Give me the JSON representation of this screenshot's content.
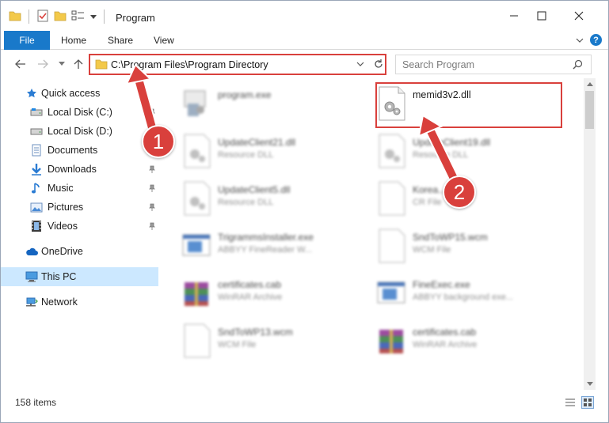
{
  "window": {
    "title": "Program"
  },
  "ribbon": {
    "file_tab": "File",
    "tabs": [
      "Home",
      "Share",
      "View"
    ],
    "help": "?"
  },
  "address": {
    "path": "C:\\Program Files\\Program Directory"
  },
  "search": {
    "placeholder": "Search Program"
  },
  "nav": {
    "items": [
      {
        "label": "Quick access",
        "icon": "star-icon"
      },
      {
        "label": "Local Disk (C:)",
        "icon": "drive-icon"
      },
      {
        "label": "Local Disk (D:)",
        "icon": "drive-icon"
      },
      {
        "label": "Documents",
        "icon": "documents-icon"
      },
      {
        "label": "Downloads",
        "icon": "download-icon"
      },
      {
        "label": "Music",
        "icon": "music-icon"
      },
      {
        "label": "Pictures",
        "icon": "pictures-icon"
      },
      {
        "label": "Videos",
        "icon": "videos-icon"
      },
      {
        "label": "OneDrive",
        "icon": "cloud-icon"
      },
      {
        "label": "This PC",
        "icon": "computer-icon"
      },
      {
        "label": "Network",
        "icon": "network-icon"
      }
    ]
  },
  "files": [
    {
      "name": "program.exe",
      "type": ""
    },
    {
      "name": "memid3v2.dll",
      "type": ""
    },
    {
      "name": "UpdateClient21.dll",
      "type": "Resource DLL"
    },
    {
      "name": "UpdateClient19.dll",
      "type": "Resource DLL"
    },
    {
      "name": "UpdateClient5.dll",
      "type": "Resource DLL"
    },
    {
      "name": "Korea...",
      "type": "CR File"
    },
    {
      "name": "TrigrammsInstaller.exe",
      "type": "ABBYY FineReader W..."
    },
    {
      "name": "SndToWP15.wcm",
      "type": "WCM File"
    },
    {
      "name": "certificates.cab",
      "type": "WinRAR Archive"
    },
    {
      "name": "FineExec.exe",
      "type": "ABBYY background exe..."
    },
    {
      "name": "SndToWP13.wcm",
      "type": "WCM File"
    },
    {
      "name": "certificates.cab",
      "type": "WinRAR Archive"
    }
  ],
  "status": {
    "item_count": "158 items"
  },
  "annotations": {
    "step1": "1",
    "step2": "2",
    "color": "#d9403c"
  }
}
